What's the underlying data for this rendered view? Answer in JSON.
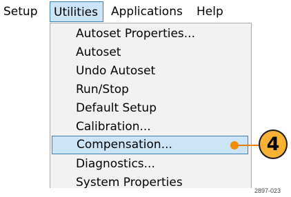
{
  "menubar": {
    "items": [
      {
        "label": "Setup"
      },
      {
        "label": "Utilities"
      },
      {
        "label": "Applications"
      },
      {
        "label": "Help"
      }
    ],
    "active": "Utilities"
  },
  "dropdown": {
    "items": [
      {
        "label": "Autoset Properties..."
      },
      {
        "label": "Autoset"
      },
      {
        "label": "Undo Autoset"
      },
      {
        "label": "Run/Stop"
      },
      {
        "label": "Default Setup"
      },
      {
        "label": "Calibration..."
      },
      {
        "label": "Compensation..."
      },
      {
        "label": "Diagnostics..."
      },
      {
        "label": "System Properties"
      }
    ],
    "highlighted": "Compensation..."
  },
  "callout": {
    "number": "4",
    "color": "#f9b233"
  },
  "figure_id": "2897-023",
  "colors": {
    "highlight": "#cce4f7",
    "highlight_border": "#3c7fb1",
    "menu_bg": "#f2f2f2"
  }
}
